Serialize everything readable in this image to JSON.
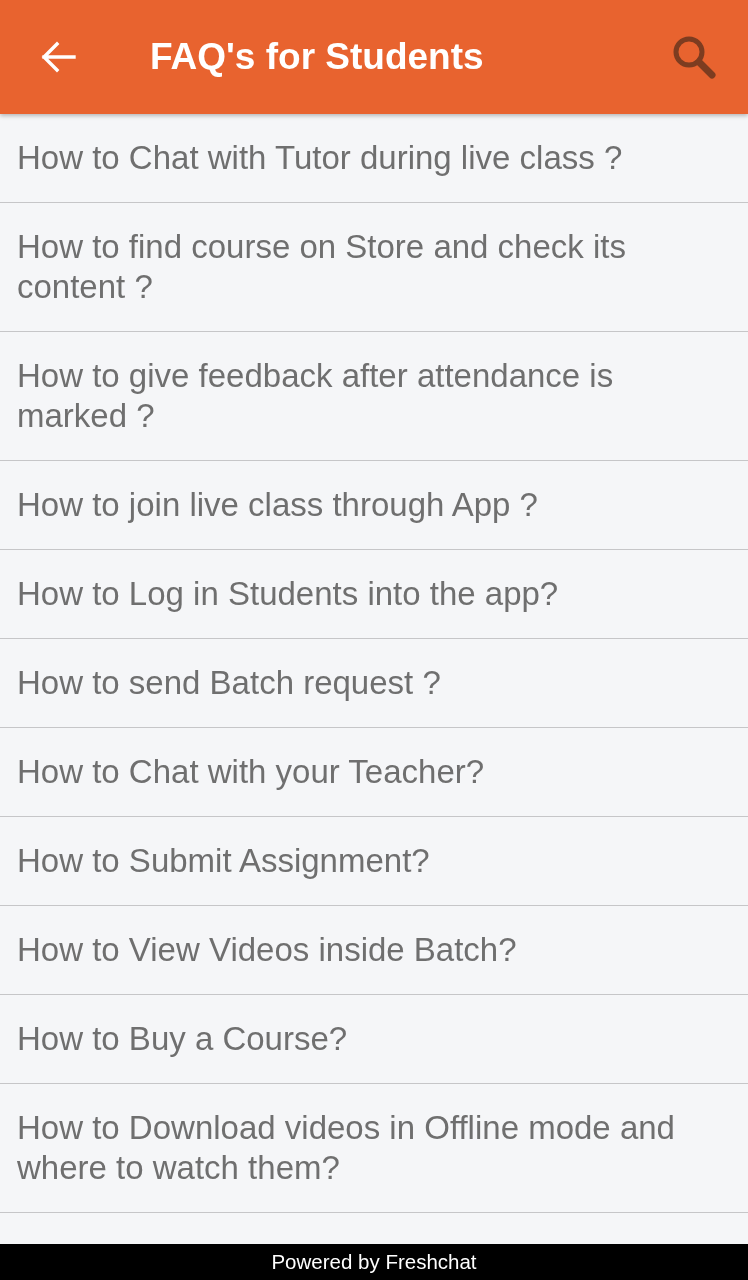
{
  "app_bar": {
    "title": "FAQ's for Students"
  },
  "faqs": [
    {
      "question": "How to Chat with Tutor during live class ?"
    },
    {
      "question": "How to find course on Store and check its content ?"
    },
    {
      "question": "How to give feedback after attendance is marked ?"
    },
    {
      "question": "How to join live class through App ?"
    },
    {
      "question": "How to Log in Students into the app?"
    },
    {
      "question": "How to send Batch request ?"
    },
    {
      "question": "How to Chat with your Teacher?"
    },
    {
      "question": "How to Submit Assignment?"
    },
    {
      "question": "How to View Videos inside Batch?"
    },
    {
      "question": "How to Buy a Course?"
    },
    {
      "question": "How to Download videos in Offline mode and where to watch them?"
    }
  ],
  "footer": {
    "text": "Powered by Freshchat"
  }
}
